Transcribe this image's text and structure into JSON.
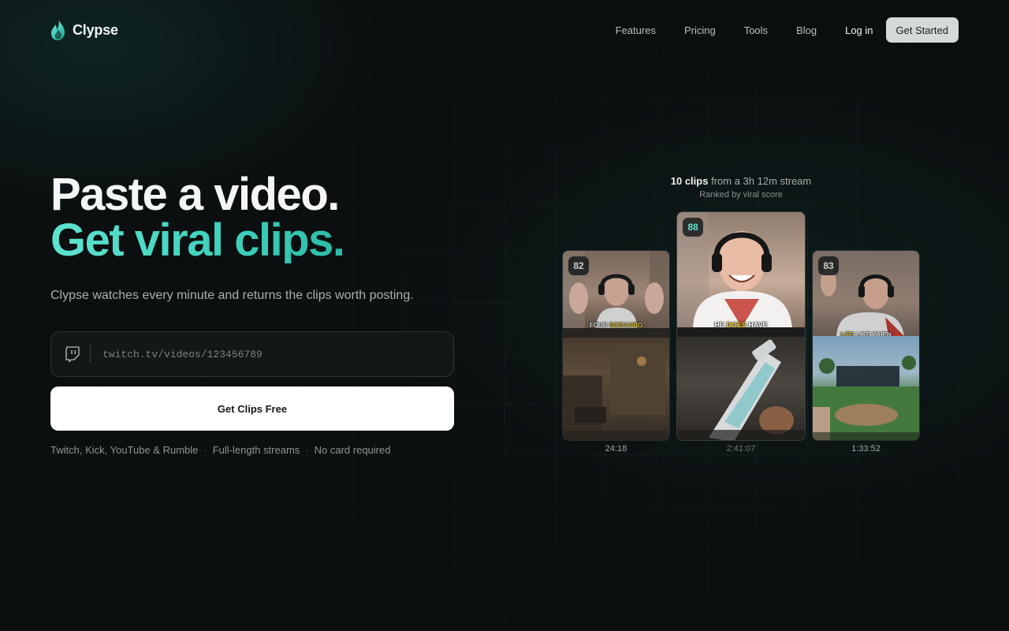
{
  "brand": {
    "name": "Clypse",
    "accent": "#3fd0bb"
  },
  "nav": {
    "links": [
      "Features",
      "Pricing",
      "Tools",
      "Blog"
    ],
    "login": "Log in",
    "cta": "Get Started"
  },
  "hero": {
    "line1": "Paste a video.",
    "line2": "Get viral clips.",
    "subtitle": "Clypse watches every minute and returns the clips worth posting.",
    "input_placeholder": "twitch.tv/videos/123456789",
    "input_icon": "twitch-icon",
    "cta": "Get Clips Free",
    "features": [
      "Twitch, Kick, YouTube & Rumble",
      "Full-length streams",
      "No card required"
    ]
  },
  "showcase": {
    "count": "10 clips",
    "count_rest": "from a 3h 12m stream",
    "subtitle": "Ranked by viral score",
    "clips": [
      {
        "score": "82",
        "caption_a": "FOUR ",
        "caption_b": "SCENARIO",
        "duration": "24:18"
      },
      {
        "score": "88",
        "caption_a": "HE ",
        "caption_b": "DOES",
        "caption_c": " HAVE",
        "duration": "2:41:07"
      },
      {
        "score": "83",
        "caption_a": "",
        "caption_b": "LIFE",
        "caption_c": " LIKE WHEN",
        "duration": "1:33:52"
      }
    ]
  }
}
